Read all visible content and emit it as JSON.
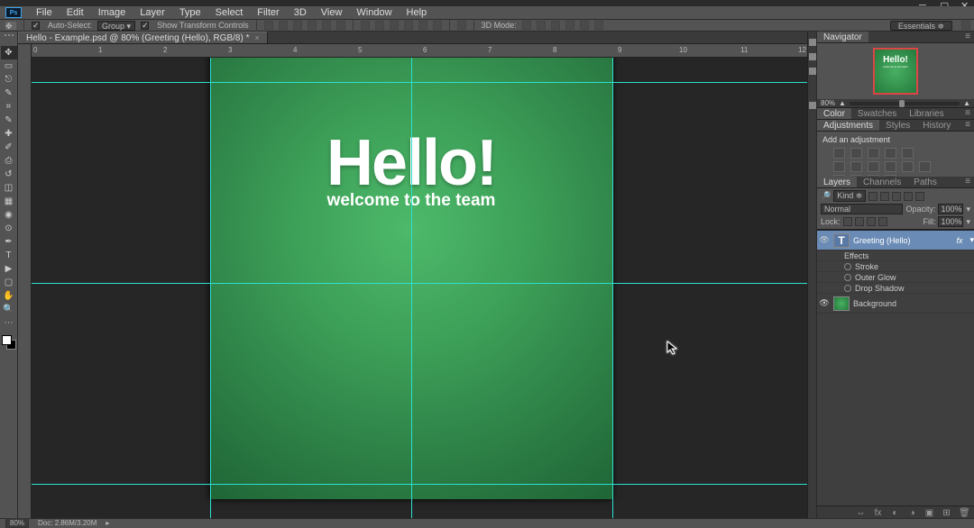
{
  "menubar": [
    "File",
    "Edit",
    "Image",
    "Layer",
    "Type",
    "Select",
    "Filter",
    "3D",
    "View",
    "Window",
    "Help"
  ],
  "optbar": {
    "auto_select": "Auto-Select:",
    "group": "Group",
    "show_tc": "Show Transform Controls",
    "mode3d": "3D Mode:",
    "essentials": "Essentials"
  },
  "tab": {
    "title": "Hello - Example.psd @ 80% (Greeting (Hello), RGB/8) *"
  },
  "ruler": [
    "0",
    "1",
    "2",
    "3",
    "4",
    "5",
    "6",
    "7",
    "8",
    "9",
    "10",
    "11",
    "12"
  ],
  "artwork": {
    "h1": "Hello!",
    "h2": "welcome to the team"
  },
  "panels": {
    "nav_tab": "Navigator",
    "nav_zoom": "80%",
    "color_tabs": [
      "Color",
      "Swatches",
      "Libraries"
    ],
    "adj_tabs": [
      "Adjustments",
      "Styles",
      "History"
    ],
    "adj_title": "Add an adjustment",
    "layer_tabs": [
      "Layers",
      "Channels",
      "Paths"
    ],
    "kind": "Kind",
    "blend": "Normal",
    "opacity_lbl": "Opacity:",
    "opacity_val": "100%",
    "lock_lbl": "Lock:",
    "fill_lbl": "Fill:",
    "fill_val": "100%",
    "layers": [
      {
        "name": "Greeting (Hello)",
        "type": "T",
        "fx": "fx",
        "selected": true
      },
      {
        "name": "Background",
        "type": "bg",
        "selected": false
      }
    ],
    "effects_hdr": "Effects",
    "effects": [
      "Stroke",
      "Outer Glow",
      "Drop Shadow"
    ]
  },
  "status": {
    "zoom": "80%",
    "doc": "Doc: 2.86M/3.20M"
  }
}
